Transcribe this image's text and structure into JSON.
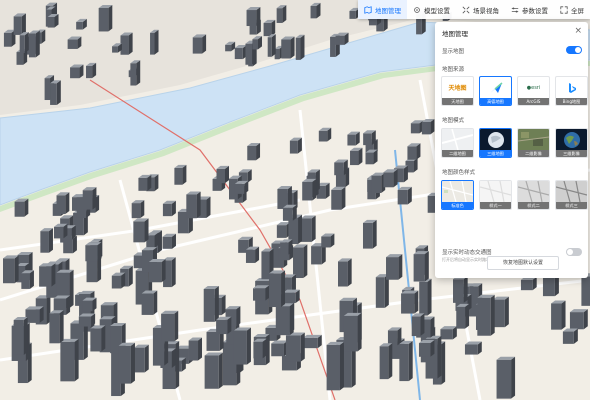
{
  "toolbar": {
    "items": [
      {
        "label": "地图管理",
        "icon": "map-icon",
        "active": true
      },
      {
        "label": "模型设置",
        "icon": "settings-icon",
        "active": false
      },
      {
        "label": "场景视角",
        "icon": "scene-icon",
        "active": false
      },
      {
        "label": "参数设置",
        "icon": "sliders-icon",
        "active": false
      },
      {
        "label": "全屏",
        "icon": "fullscreen-icon",
        "active": false
      }
    ]
  },
  "panel": {
    "title": "地图管理",
    "close": "×",
    "show_map": {
      "label": "显示地图",
      "on": true
    },
    "source": {
      "label": "地图来源",
      "options": [
        {
          "caption": "天地图",
          "selected": false
        },
        {
          "caption": "高德地图",
          "selected": true
        },
        {
          "caption": "ArcGIS",
          "selected": false
        },
        {
          "caption": "Bing地图",
          "selected": false
        }
      ]
    },
    "mode": {
      "label": "地图模式",
      "options": [
        {
          "caption": "二维地图",
          "selected": false
        },
        {
          "caption": "三维地图",
          "selected": true
        },
        {
          "caption": "二维影像",
          "selected": false
        },
        {
          "caption": "三维影像",
          "selected": false
        }
      ]
    },
    "color": {
      "label": "地图颜色样式",
      "options": [
        {
          "caption": "标准色",
          "selected": true
        },
        {
          "caption": "样式一",
          "selected": false
        },
        {
          "caption": "样式二",
          "selected": false
        },
        {
          "caption": "样式三",
          "selected": false
        }
      ]
    },
    "dynamic": {
      "label": "显示实时动态交通图",
      "note": "打开后将自动显示实时路况信息",
      "on": false
    },
    "reset_label": "恢复地图默认设置"
  },
  "colors": {
    "accent": "#1677ff",
    "water": "#cde2f5",
    "ground": "#f3efe6",
    "building": "#5a5f68"
  }
}
